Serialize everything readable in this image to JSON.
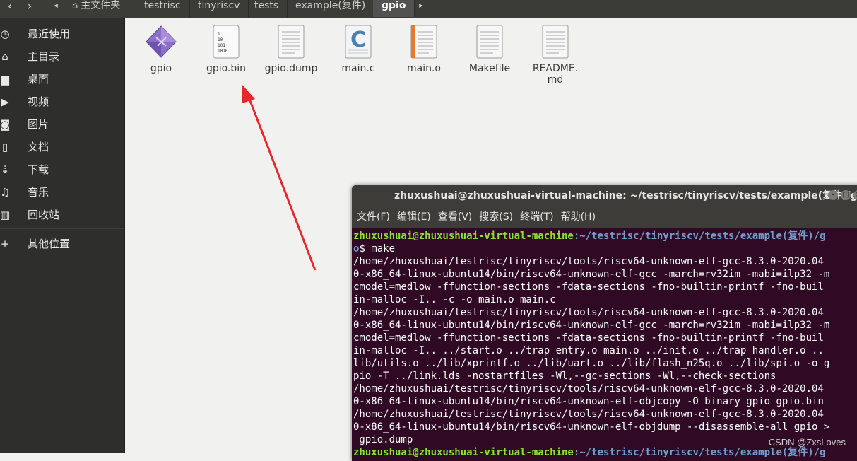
{
  "pathbar": {
    "back": "‹",
    "forward": "›",
    "crumbs": [
      "主文件夹",
      "testrisc",
      "tinyriscv",
      "tests",
      "example(复件)",
      "gpio"
    ],
    "more": "▸"
  },
  "sidebar": {
    "items": [
      {
        "label": "最近使用",
        "icon": "clock-icon",
        "glyph": "◷"
      },
      {
        "label": "主目录",
        "icon": "home-icon",
        "glyph": "⌂"
      },
      {
        "label": "桌面",
        "icon": "folder-icon",
        "glyph": "▆"
      },
      {
        "label": "视频",
        "icon": "video-icon",
        "glyph": "▶"
      },
      {
        "label": "图片",
        "icon": "camera-icon",
        "glyph": "◙"
      },
      {
        "label": "文档",
        "icon": "document-icon",
        "glyph": "▯"
      },
      {
        "label": "下载",
        "icon": "download-icon",
        "glyph": "⇣"
      },
      {
        "label": "音乐",
        "icon": "music-icon",
        "glyph": "♫"
      },
      {
        "label": "回收站",
        "icon": "trash-icon",
        "glyph": "▥"
      },
      {
        "label": "其他位置",
        "icon": "plus-icon",
        "glyph": "+"
      }
    ]
  },
  "files": [
    {
      "name": "gpio",
      "icon": "executable-icon"
    },
    {
      "name": "gpio.bin",
      "icon": "binary-file-icon",
      "glyph": "1\n10\n101\n1010"
    },
    {
      "name": "gpio.dump",
      "icon": "text-file-icon"
    },
    {
      "name": "main.c",
      "icon": "c-source-icon",
      "glyph": "C"
    },
    {
      "name": "main.o",
      "icon": "object-file-icon"
    },
    {
      "name": "Makefile",
      "icon": "text-file-icon"
    },
    {
      "name": "README.\nmd",
      "icon": "text-file-icon"
    }
  ],
  "terminal": {
    "title": "zhuxushuai@zhuxushuai-virtual-machine: ~/testrisc/tinyriscv/tests/example(复件)/gpio",
    "menu": [
      "文件(F)",
      "编辑(E)",
      "查看(V)",
      "搜索(S)",
      "终端(T)",
      "帮助(H)"
    ],
    "prompt_user": "zhuxushuai@zhuxushuai-virtual-machine",
    "prompt_path": ":~/testrisc/tinyriscv/tests/example(复件)/g",
    "prompt_path_tail": "o",
    "command": "$ make",
    "output": [
      "/home/zhuxushuai/testrisc/tinyriscv/tools/riscv64-unknown-elf-gcc-8.3.0-2020.04",
      "0-x86_64-linux-ubuntu14/bin/riscv64-unknown-elf-gcc -march=rv32im -mabi=ilp32 -m",
      "cmodel=medlow -ffunction-sections -fdata-sections -fno-builtin-printf -fno-buil",
      "in-malloc -I.. -c -o main.o main.c",
      "/home/zhuxushuai/testrisc/tinyriscv/tools/riscv64-unknown-elf-gcc-8.3.0-2020.04",
      "0-x86_64-linux-ubuntu14/bin/riscv64-unknown-elf-gcc -march=rv32im -mabi=ilp32 -m",
      "cmodel=medlow -ffunction-sections -fdata-sections -fno-builtin-printf -fno-buil",
      "in-malloc -I.. ../start.o ../trap_entry.o main.o ../init.o ../trap_handler.o ..",
      "lib/utils.o ../lib/xprintf.o ../lib/uart.o ../lib/flash_n25q.o ../lib/spi.o -o g",
      "pio -T ../link.lds -nostartfiles -Wl,--gc-sections -Wl,--check-sections",
      "/home/zhuxushuai/testrisc/tinyriscv/tools/riscv64-unknown-elf-gcc-8.3.0-2020.04",
      "0-x86_64-linux-ubuntu14/bin/riscv64-unknown-elf-objcopy -O binary gpio gpio.bin",
      "/home/zhuxushuai/testrisc/tinyriscv/tools/riscv64-unknown-elf-gcc-8.3.0-2020.04",
      "0-x86_64-linux-ubuntu14/bin/riscv64-unknown-elf-objdump --disassemble-all gpio >",
      " gpio.dump"
    ],
    "last_prompt_user": "zhuxushuai@zhuxushuai-virtual-machine",
    "last_prompt_path": ":~/testrisc/tinyriscv/tests/example(复件)/g"
  },
  "watermark": "CSDN @ZxsLoves",
  "colors": {
    "annotation_arrow": "#e8262b",
    "terminal_bg": "#300a24",
    "prompt_user": "#8ae234",
    "prompt_path": "#729fcf"
  }
}
